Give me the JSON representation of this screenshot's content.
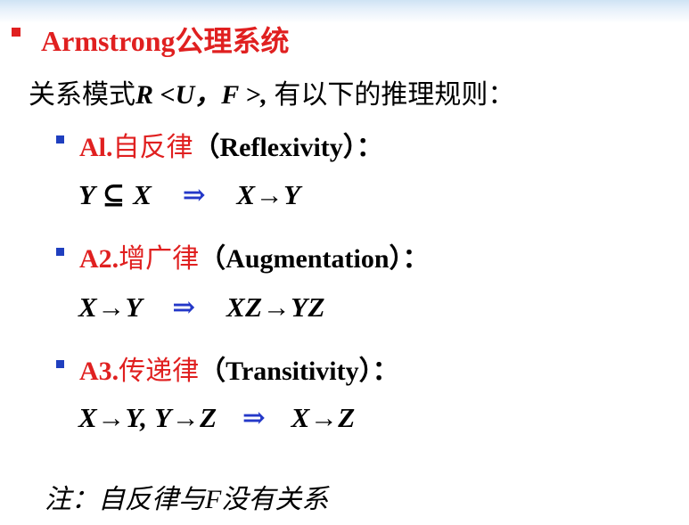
{
  "title": {
    "name": "Armstrong",
    "suffix": "公理系统"
  },
  "intro": {
    "prefix": "关系模式",
    "schema": "R <U，F >,",
    "suffix": " 有以下的推理规则："
  },
  "rules": [
    {
      "label": "Al.",
      "name_zh": "自反律",
      "name_en": "（Reflexivity）：",
      "formula_lhs": "Y ⊆ X",
      "implies": "⇒",
      "formula_rhs": "X→Y"
    },
    {
      "label": "A2.",
      "name_zh": "增广律",
      "name_en": "（Augmentation）：",
      "formula_lhs": "X→Y",
      "implies": "⇒",
      "formula_rhs": "XZ→YZ"
    },
    {
      "label": "A3.",
      "name_zh": "传递律",
      "name_en": "（Transitivity）：",
      "formula_lhs": "X→Y,  Y→Z",
      "implies": "⇒",
      "formula_rhs": "X→Z"
    }
  ],
  "note": "注：自反律与F没有关系",
  "colors": {
    "red": "#e02020",
    "bullet_blue": "#1f3fbf",
    "implies_blue": "#2438c8"
  }
}
